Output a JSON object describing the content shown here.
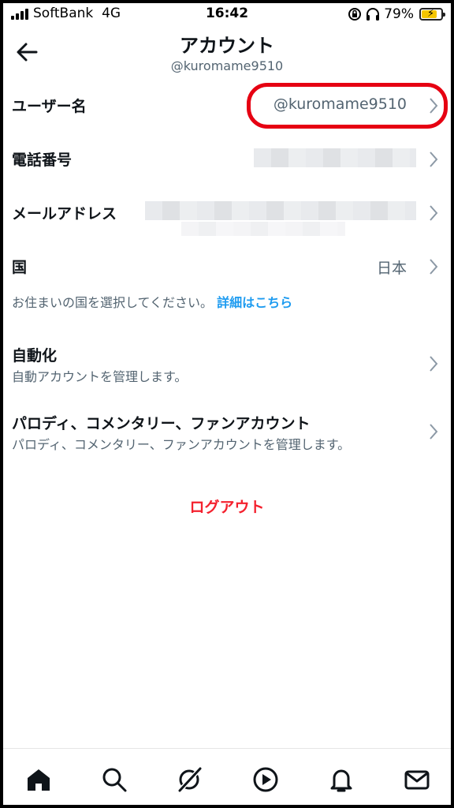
{
  "status_bar": {
    "carrier": "SoftBank",
    "network": "4G",
    "time": "16:42",
    "battery": "79%",
    "battery_level": 0.79
  },
  "header": {
    "title": "アカウント",
    "handle": "@kuromame9510"
  },
  "rows": {
    "username": {
      "label": "ユーザー名",
      "value": "@kuromame9510"
    },
    "phone": {
      "label": "電話番号"
    },
    "email": {
      "label": "メールアドレス"
    },
    "country": {
      "label": "国",
      "value": "日本",
      "note": "お住まいの国を選択してください。",
      "link": "詳細はこちら"
    },
    "automation": {
      "label": "自動化",
      "desc": "自動アカウントを管理します。"
    },
    "parody": {
      "label": "パロディ、コメンタリー、ファンアカウント",
      "desc": "パロディ、コメンタリー、ファンアカウントを管理します。"
    }
  },
  "logout_label": "ログアウト",
  "colors": {
    "accent_link": "#1d9bf0",
    "logout": "#f4212e",
    "highlight_ring": "#e60012",
    "battery_fill": "#f5c600"
  },
  "tabs": [
    "home-icon",
    "search-icon",
    "grok-icon",
    "video-icon",
    "notifications-icon",
    "messages-icon"
  ]
}
